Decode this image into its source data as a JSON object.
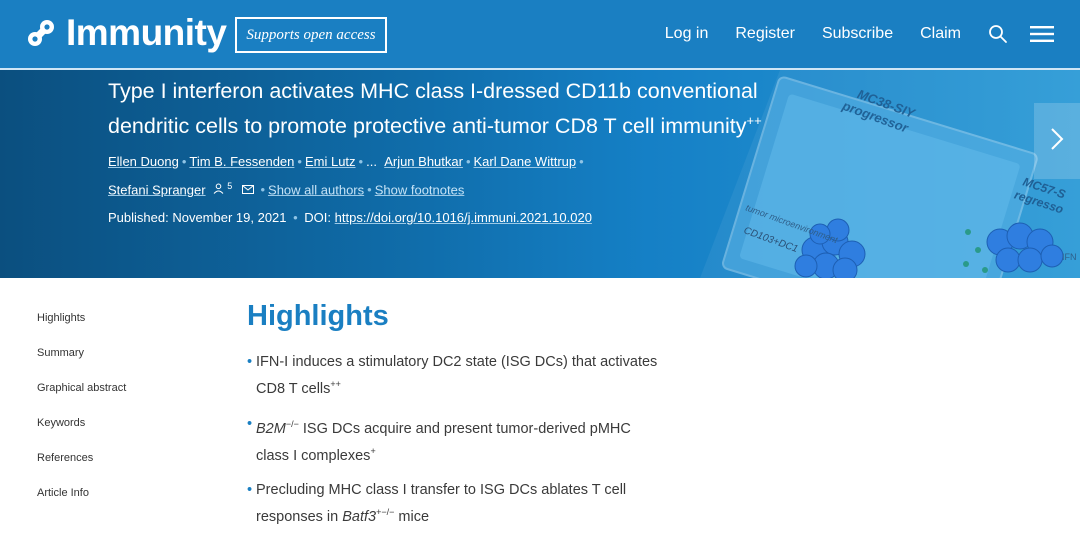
{
  "header": {
    "brand": "Immunity",
    "open_access_badge": "Supports open access",
    "nav": {
      "login": "Log in",
      "register": "Register",
      "subscribe": "Subscribe",
      "claim": "Claim"
    },
    "accent_color": "#1a7fc2"
  },
  "hero": {
    "title": "Type I interferon activates MHC class I-dressed CD11b conventional dendritic cells to promote protective anti-tumor CD8 T cell immunity",
    "title_sup": "++",
    "authors": [
      "Ellen Duong",
      "Tim B. Fessenden",
      "Emi Lutz",
      "...",
      "Arjun Bhutkar",
      "Karl Dane Wittrup",
      "Stefani Spranger"
    ],
    "author_count": "5",
    "show_all_authors": "Show all authors",
    "show_footnotes": "Show footnotes",
    "published_label": "Published: November 19, 2021",
    "doi_label": "DOI:",
    "doi_link": "https://doi.org/10.1016/j.immuni.2021.10.020",
    "art_labels": {
      "panel_a": "MC38-SIY",
      "panel_a2": "progressor",
      "panel_b": "MC57-S",
      "panel_b2": "regresso",
      "micro": "tumor microenvironment",
      "dc": "CD103+DC1",
      "ifn": "IFN"
    }
  },
  "sidebar": {
    "items": [
      {
        "label": "Highlights"
      },
      {
        "label": "Summary"
      },
      {
        "label": "Graphical abstract"
      },
      {
        "label": "Keywords"
      },
      {
        "label": "References"
      },
      {
        "label": "Article Info"
      }
    ]
  },
  "main": {
    "heading": "Highlights",
    "highlights": [
      {
        "line1": "IFN-I induces a stimulatory DC2 state (ISG DCs) that activates",
        "line2": "CD8 T cells",
        "line2_sup": "++"
      },
      {
        "gene": "B2M",
        "gene_sup": "−/−",
        "line1": " ISG DCs acquire and present tumor-derived pMHC",
        "line2": "class I complexes",
        "line2_sup": "+"
      },
      {
        "line1": "Precluding MHC class I transfer to ISG DCs ablates T cell",
        "line2_pre": "responses in ",
        "gene": "Batf3",
        "gene_sup": "+−/−",
        "line2_post": " mice"
      }
    ]
  }
}
